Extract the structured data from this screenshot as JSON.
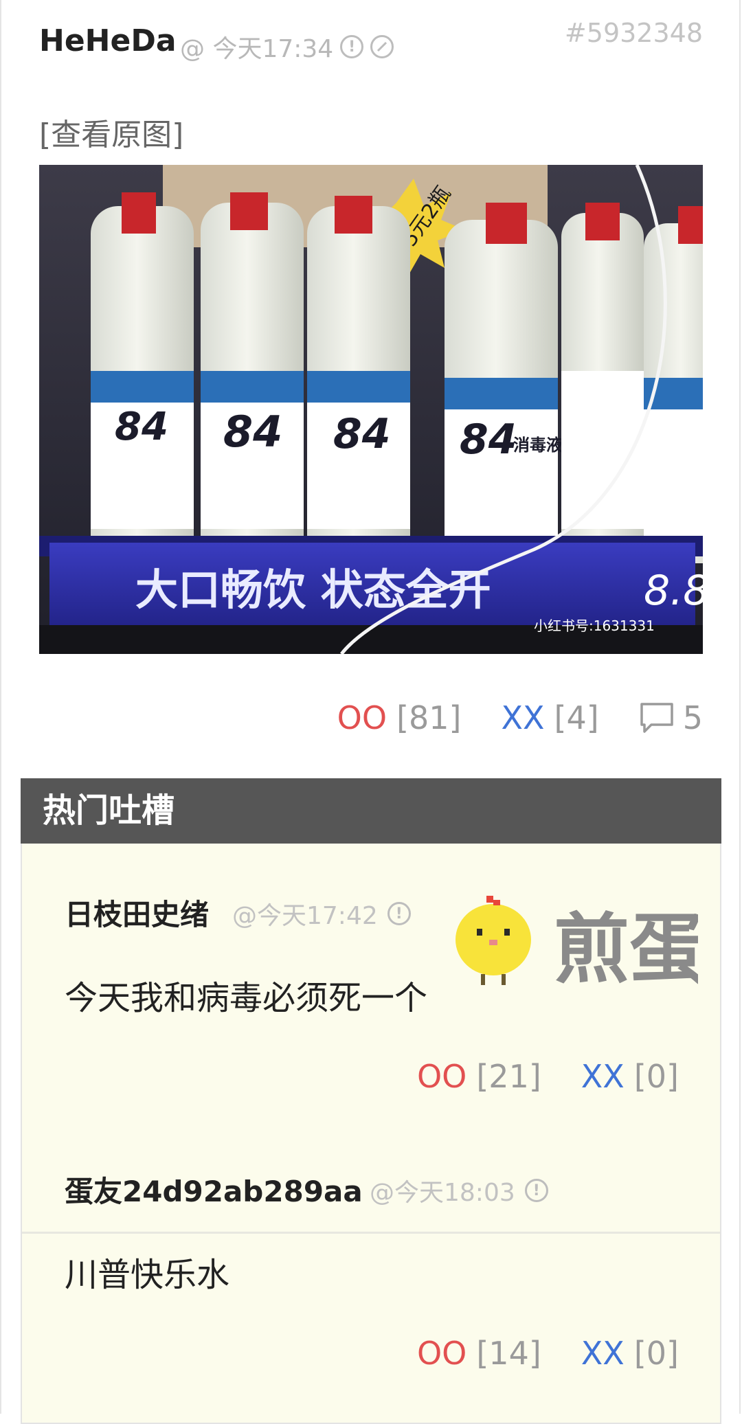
{
  "post": {
    "author": "HeHeDa",
    "time": "@ 今天17:34",
    "id": "#5932348",
    "view_original": "[查看原图]",
    "oo_label": "OO",
    "oo_count": "[81]",
    "xx_label": "XX",
    "xx_count": "[4]",
    "comment_count": "5",
    "photo": {
      "label_84": "84",
      "label_disinfect": "消毒液",
      "shelf_text": "大口畅饮 状态全开",
      "price_tag": "5元2瓶",
      "price_digits": "8.8",
      "watermark": "小红书号:1631331"
    }
  },
  "hot_comments": {
    "title": "热门吐槽",
    "logo_text": "煎蛋",
    "items": [
      {
        "author": "日枝田史绪",
        "time": "@今天17:42",
        "text": "今天我和病毒必须死一个",
        "oo_label": "OO",
        "oo_count": "[21]",
        "xx_label": "XX",
        "xx_count": "[0]"
      },
      {
        "author": "蛋友24d92ab289aa",
        "time": "@今天18:03",
        "text": "川普快乐水",
        "oo_label": "OO",
        "oo_count": "[14]",
        "xx_label": "XX",
        "xx_count": "[0]"
      }
    ]
  },
  "icons": [
    "report-icon",
    "block-icon",
    "comment-icon"
  ],
  "colors": {
    "oo": "#e25050",
    "xx": "#3f73d6",
    "hot_header": "#565656",
    "comment_bg": "#fcfcec"
  }
}
